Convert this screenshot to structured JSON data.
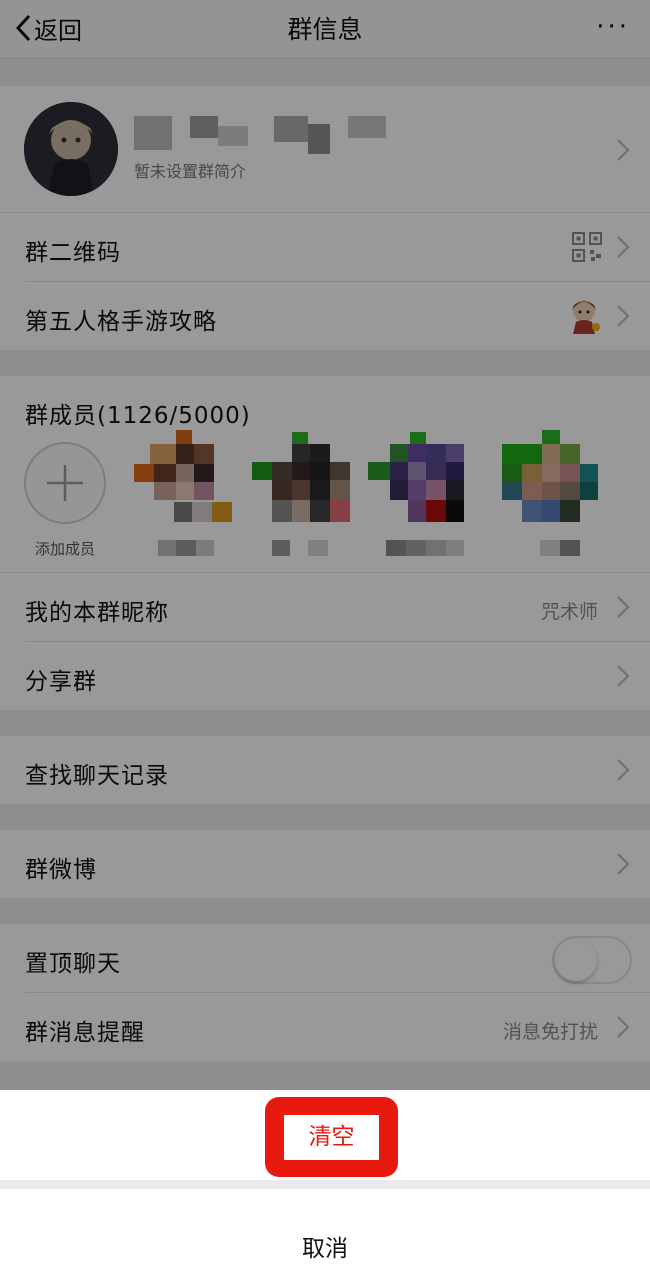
{
  "nav": {
    "back_label": "返回",
    "title": "群信息",
    "more_label": "···"
  },
  "group": {
    "intro": "暂未设置群简介"
  },
  "rows": {
    "qrcode": "群二维码",
    "app": "第五人格手游攻略",
    "members_title": "群成员(1126/5000)",
    "add_member": "添加成员",
    "nickname_label": "我的本群昵称",
    "nickname_value": "咒术师",
    "share": "分享群",
    "search_history": "查找聊天记录",
    "weibo": "群微博",
    "pin_chat": "置顶聊天",
    "notify_label": "群消息提醒",
    "notify_value": "消息免打扰"
  },
  "toggles": {
    "pin_chat": false
  },
  "sheet": {
    "clear_label": "清空",
    "cancel_label": "取消"
  },
  "colors": {
    "highlight": "#e8190f",
    "overlay": "rgba(0,0,0,0.40)"
  },
  "icons": {
    "back": "chevron-left-icon",
    "more": "more-dots-icon",
    "qrcode": "qrcode-icon",
    "add": "plus-icon",
    "chevron": "chevron-right-icon"
  }
}
